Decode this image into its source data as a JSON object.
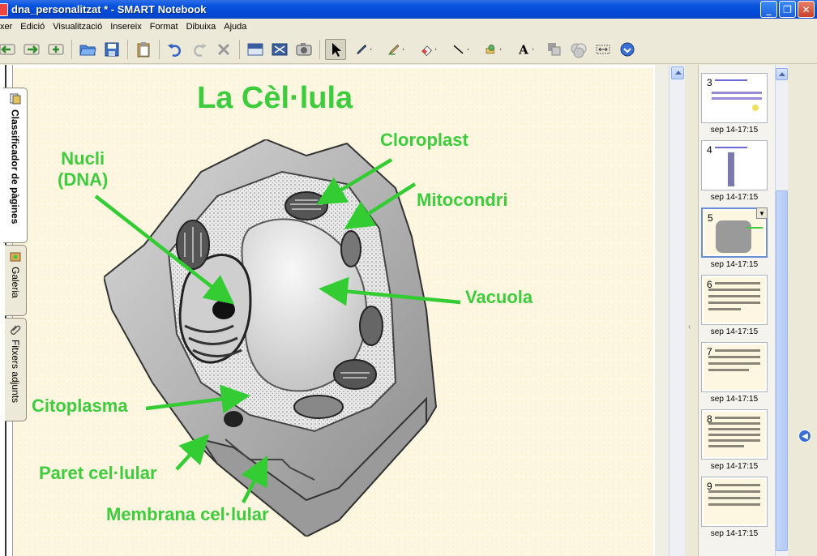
{
  "window": {
    "title": "dna_personalitzat * - SMART Notebook",
    "buttons": {
      "minimize": "_",
      "restore": "❐",
      "close": "✕"
    }
  },
  "menu": {
    "items": [
      "xer",
      "Edició",
      "Visualització",
      "Insereix",
      "Format",
      "Dibuixa",
      "Ajuda"
    ]
  },
  "toolbar": {
    "icons": [
      "back-icon",
      "forward-icon",
      "add-page-icon",
      "open-folder-icon",
      "save-icon",
      "paste-icon",
      "undo-icon",
      "redo-icon",
      "delete-icon",
      "screen-shade-icon",
      "full-screen-icon",
      "screen-capture-icon",
      "select-arrow-icon",
      "pen-icon",
      "creative-pen-icon",
      "eraser-icon",
      "line-icon",
      "shapes-icon",
      "text-icon",
      "properties-icon",
      "fill-icon",
      "toolbar-move-icon",
      "toolbar-options-icon"
    ]
  },
  "slide": {
    "title": "La Cèl·lula",
    "labels": {
      "nucli": "Nucli\n(DNA)",
      "cloroplast": "Cloroplast",
      "mitocondri": "Mitocondri",
      "vacuola": "Vacuola",
      "citoplasma": "Citoplasma",
      "paret": "Paret cel·lular",
      "membrana": "Membrana cel·lular"
    },
    "label_color": "#3ccc3c",
    "background_color": "#fdf7e2"
  },
  "sorter": {
    "pages": [
      {
        "num": "3",
        "time": "sep 14-17:15",
        "selected": false
      },
      {
        "num": "4",
        "time": "sep 14-17:15",
        "selected": false
      },
      {
        "num": "5",
        "time": "sep 14-17:15",
        "selected": true
      },
      {
        "num": "6",
        "time": "sep 14-17:15",
        "selected": false
      },
      {
        "num": "7",
        "time": "sep 14-17:15",
        "selected": false
      },
      {
        "num": "8",
        "time": "sep 14-17:15",
        "selected": false
      },
      {
        "num": "9",
        "time": "sep 14-17:15",
        "selected": false
      }
    ]
  },
  "sidetabs": {
    "page_sorter": "Classificador de pàgines",
    "gallery": "Galeria",
    "attachments": "Fitxers adjunts"
  }
}
